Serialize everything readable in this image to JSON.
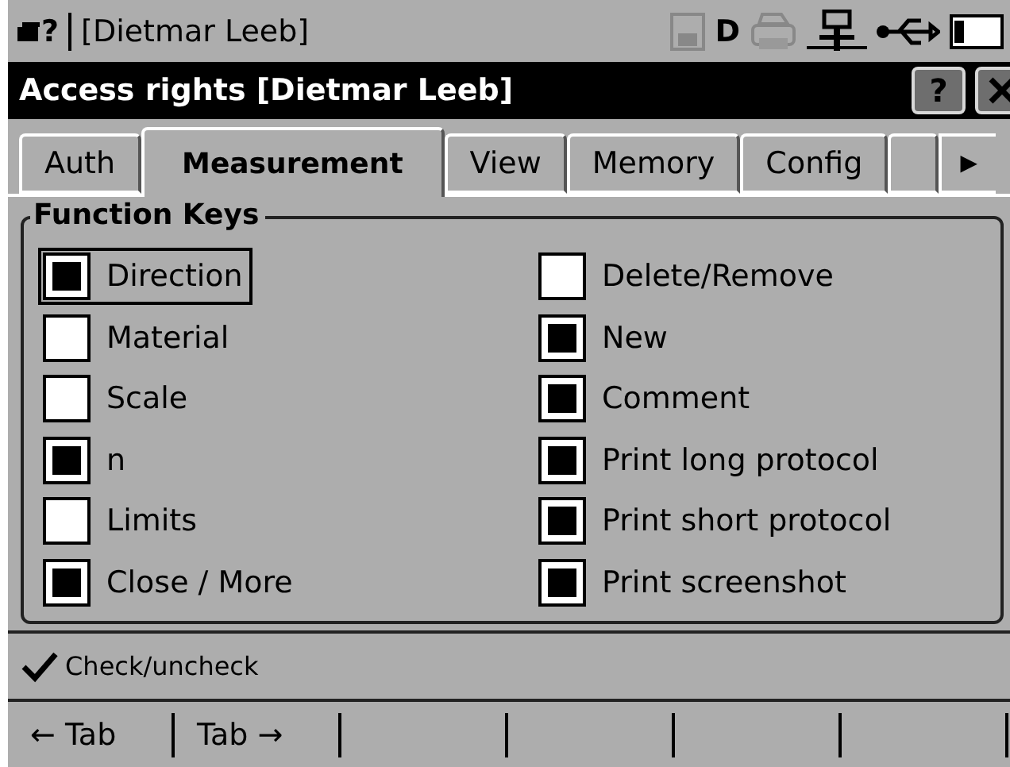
{
  "status_bar": {
    "help_mark": "?",
    "user": "[Dietmar Leeb]",
    "drive_letter": "D"
  },
  "window": {
    "title": "Access rights [Dietmar Leeb]",
    "help_button": "?"
  },
  "tabs": [
    {
      "label": "Auth",
      "selected": false
    },
    {
      "label": "Measurement",
      "selected": true
    },
    {
      "label": "View",
      "selected": false
    },
    {
      "label": "Memory",
      "selected": false
    },
    {
      "label": "Config",
      "selected": false
    }
  ],
  "tab_scroll": "▶",
  "group": {
    "title": "Function Keys",
    "columns": [
      [
        {
          "label": "Direction",
          "checked": true,
          "focused": true
        },
        {
          "label": "Material",
          "checked": false,
          "focused": false
        },
        {
          "label": "Scale",
          "checked": false,
          "focused": false
        },
        {
          "label": "n",
          "checked": true,
          "focused": false
        },
        {
          "label": "Limits",
          "checked": false,
          "focused": false
        },
        {
          "label": "Close / More",
          "checked": true,
          "focused": false
        }
      ],
      [
        {
          "label": "Delete/Remove",
          "checked": false,
          "focused": false
        },
        {
          "label": "New",
          "checked": true,
          "focused": false
        },
        {
          "label": "Comment",
          "checked": true,
          "focused": false
        },
        {
          "label": "Print long protocol",
          "checked": true,
          "focused": false
        },
        {
          "label": "Print short protocol",
          "checked": true,
          "focused": false
        },
        {
          "label": "Print screenshot",
          "checked": true,
          "focused": false
        }
      ]
    ]
  },
  "hint": {
    "text": "Check/uncheck"
  },
  "softkeys": [
    "← Tab",
    "Tab →"
  ]
}
